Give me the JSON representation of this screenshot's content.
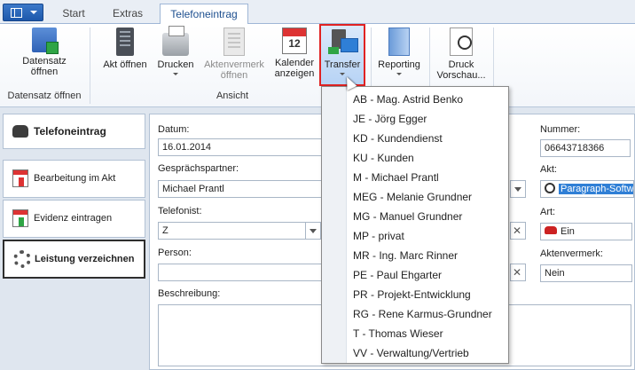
{
  "tabs": [
    {
      "label": "Start",
      "active": false
    },
    {
      "label": "Extras",
      "active": false
    },
    {
      "label": "Telefoneintrag",
      "active": true
    }
  ],
  "ribbon": {
    "datensatz_oeffnen": "Datensatz öffnen",
    "akt_oeffnen": "Akt öffnen",
    "drucken": "Drucken",
    "aktenvermerk_oeffnen": "Aktenvermerk öffnen",
    "kalender_anzeigen": "Kalender anzeigen",
    "transfer": "Transfer",
    "reporting": "Reporting",
    "druck_vorschau": "Druck Vorschau...",
    "calendar_day": "12",
    "group_datensatz": "Datensatz öffnen",
    "group_ansicht": "Ansicht"
  },
  "sidebar": {
    "header": "Telefoneintrag",
    "items": [
      {
        "label": "Bearbeitung im Akt",
        "active": false
      },
      {
        "label": "Evidenz eintragen",
        "active": false
      },
      {
        "label": "Leistung verzeichnen",
        "active": true
      }
    ]
  },
  "form": {
    "datum_label": "Datum:",
    "datum_value": "16.01.2014",
    "nummer_label": "Nummer:",
    "nummer_value": "06643718366",
    "gespraechspartner_label": "Gesprächspartner:",
    "gespraechspartner_value": "Michael Prantl",
    "akt_label": "Akt:",
    "akt_value": "Paragraph-Softw",
    "telefonist_label": "Telefonist:",
    "telefonist_value": "Z",
    "art_label": "Art:",
    "art_value": "Ein",
    "person_label": "Person:",
    "aktenvermerk_label": "Aktenvermerk:",
    "aktenvermerk_value": "Nein",
    "beschreibung_label": "Beschreibung:"
  },
  "transfer_menu": [
    "AB - Mag. Astrid Benko",
    "JE - Jörg Egger",
    "KD - Kundendienst",
    "KU - Kunden",
    "M - Michael Prantl",
    "MEG - Melanie Grundner",
    "MG - Manuel Grundner",
    "MP - privat",
    "MR - Ing. Marc Rinner",
    "PE - Paul Ehgarter",
    "PR - Projekt-Entwicklung",
    "RG - Rene Karmus-Grundner",
    "T - Thomas Wieser",
    "VV - Verwaltung/Vertrieb"
  ],
  "icons": {
    "app_menu": "app-menu-icon",
    "transfer": "transfer-icon",
    "cursor": "mouse-pointer"
  },
  "colors": {
    "accent": "#2f7fd6",
    "highlight_border": "#e02222"
  }
}
